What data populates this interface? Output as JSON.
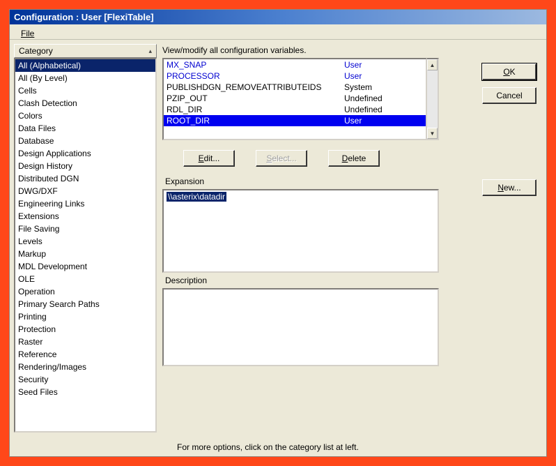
{
  "titlebar": "Configuration : User [FlexiTable]",
  "menu": {
    "file": "File"
  },
  "category": {
    "header": "Category",
    "items": [
      "All (Alphabetical)",
      "All (By Level)",
      "Cells",
      "Clash Detection",
      "Colors",
      "Data Files",
      "Database",
      "Design Applications",
      "Design History",
      "Distributed DGN",
      "DWG/DXF",
      "Engineering Links",
      "Extensions",
      "File Saving",
      "Levels",
      "Markup",
      "MDL Development",
      "OLE",
      "Operation",
      "Primary Search Paths",
      "Printing",
      "Protection",
      "Raster",
      "Reference",
      "Rendering/Images",
      "Security",
      "Seed Files"
    ],
    "selectedIndex": 0
  },
  "labels": {
    "viewmodify": "View/modify all configuration variables.",
    "expansion": "Expansion",
    "description": "Description",
    "footer": "For more options, click on the category list at left."
  },
  "variables": {
    "rows": [
      {
        "name": "MX_SNAP",
        "scope": "User",
        "class": "user"
      },
      {
        "name": "PROCESSOR",
        "scope": "User",
        "class": "user"
      },
      {
        "name": "PUBLISHDGN_REMOVEATTRIBUTEIDS",
        "scope": "System",
        "class": ""
      },
      {
        "name": "PZIP_OUT",
        "scope": "Undefined",
        "class": ""
      },
      {
        "name": "RDL_DIR",
        "scope": "Undefined",
        "class": ""
      },
      {
        "name": "ROOT_DIR",
        "scope": "User",
        "class": "selected"
      }
    ]
  },
  "buttons": {
    "edit": "Edit...",
    "select": "Select...",
    "delete": "Delete",
    "new": "New...",
    "ok": "OK",
    "cancel": "Cancel"
  },
  "expansion": {
    "value": "\\\\asterix\\datadir"
  },
  "description": {
    "value": ""
  }
}
